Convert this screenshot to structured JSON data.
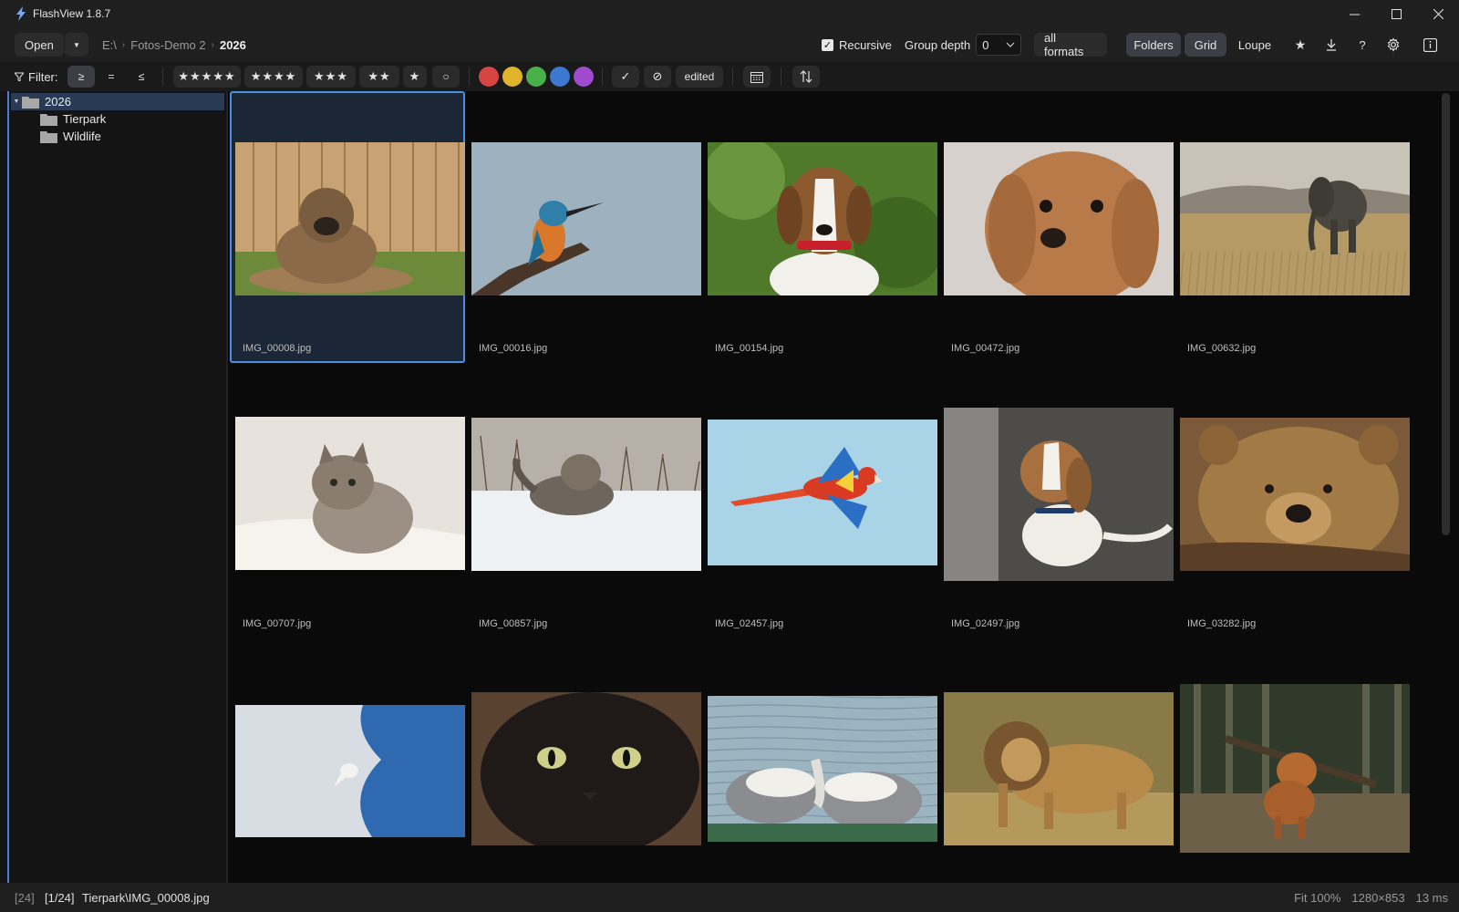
{
  "window": {
    "title": "FlashView 1.8.7",
    "controls": [
      "minimize",
      "maximize",
      "close"
    ]
  },
  "toolbar": {
    "open_label": "Open",
    "breadcrumb": [
      "E:\\",
      "Fotos-Demo 2",
      "2026"
    ],
    "recursive_label": "Recursive",
    "recursive_checked": true,
    "group_depth_label": "Group depth",
    "group_depth_value": "0",
    "formats_label": "all formats",
    "folders_label": "Folders",
    "grid_label": "Grid",
    "loupe_label": "Loupe"
  },
  "filter": {
    "label": "Filter:",
    "compare": [
      ">=",
      "=",
      "<="
    ],
    "compare_display": [
      "≥",
      "=",
      "≤"
    ],
    "ratings": [
      "★★★★★",
      "★★★★",
      "★★★",
      "★★",
      "★",
      "○"
    ],
    "colors": [
      "#d64541",
      "#e0b52c",
      "#4ab04a",
      "#3c77d0",
      "#a04ad0"
    ],
    "check": "✓",
    "reject": "⊘",
    "edited_label": "edited"
  },
  "sidebar": {
    "root": "2026",
    "children": [
      "Tierpark",
      "Wildlife"
    ]
  },
  "grid": {
    "items": [
      {
        "file": "IMG_00008.jpg",
        "subject": "puppy",
        "selected": true
      },
      {
        "file": "IMG_00016.jpg",
        "subject": "kingfisher"
      },
      {
        "file": "IMG_00154.jpg",
        "subject": "beagle"
      },
      {
        "file": "IMG_00472.jpg",
        "subject": "poodle-puppy"
      },
      {
        "file": "IMG_00632.jpg",
        "subject": "elephant"
      },
      {
        "file": "IMG_00707.jpg",
        "subject": "kitten"
      },
      {
        "file": "IMG_00857.jpg",
        "subject": "cat-in-snow"
      },
      {
        "file": "IMG_02457.jpg",
        "subject": "macaw"
      },
      {
        "file": "IMG_02497.jpg",
        "subject": "beagle-puppy"
      },
      {
        "file": "IMG_03282.jpg",
        "subject": "brown-bear"
      },
      {
        "file": "",
        "subject": "egret"
      },
      {
        "file": "",
        "subject": "black-cat"
      },
      {
        "file": "",
        "subject": "geese"
      },
      {
        "file": "",
        "subject": "lion"
      },
      {
        "file": "",
        "subject": "dog-with-stick"
      }
    ]
  },
  "status": {
    "count": "[24]",
    "position": "[1/24]",
    "file": "Tierpark\\IMG_00008.jpg",
    "zoom": "Fit 100%",
    "dimensions": "1280×853",
    "time": "13 ms"
  }
}
